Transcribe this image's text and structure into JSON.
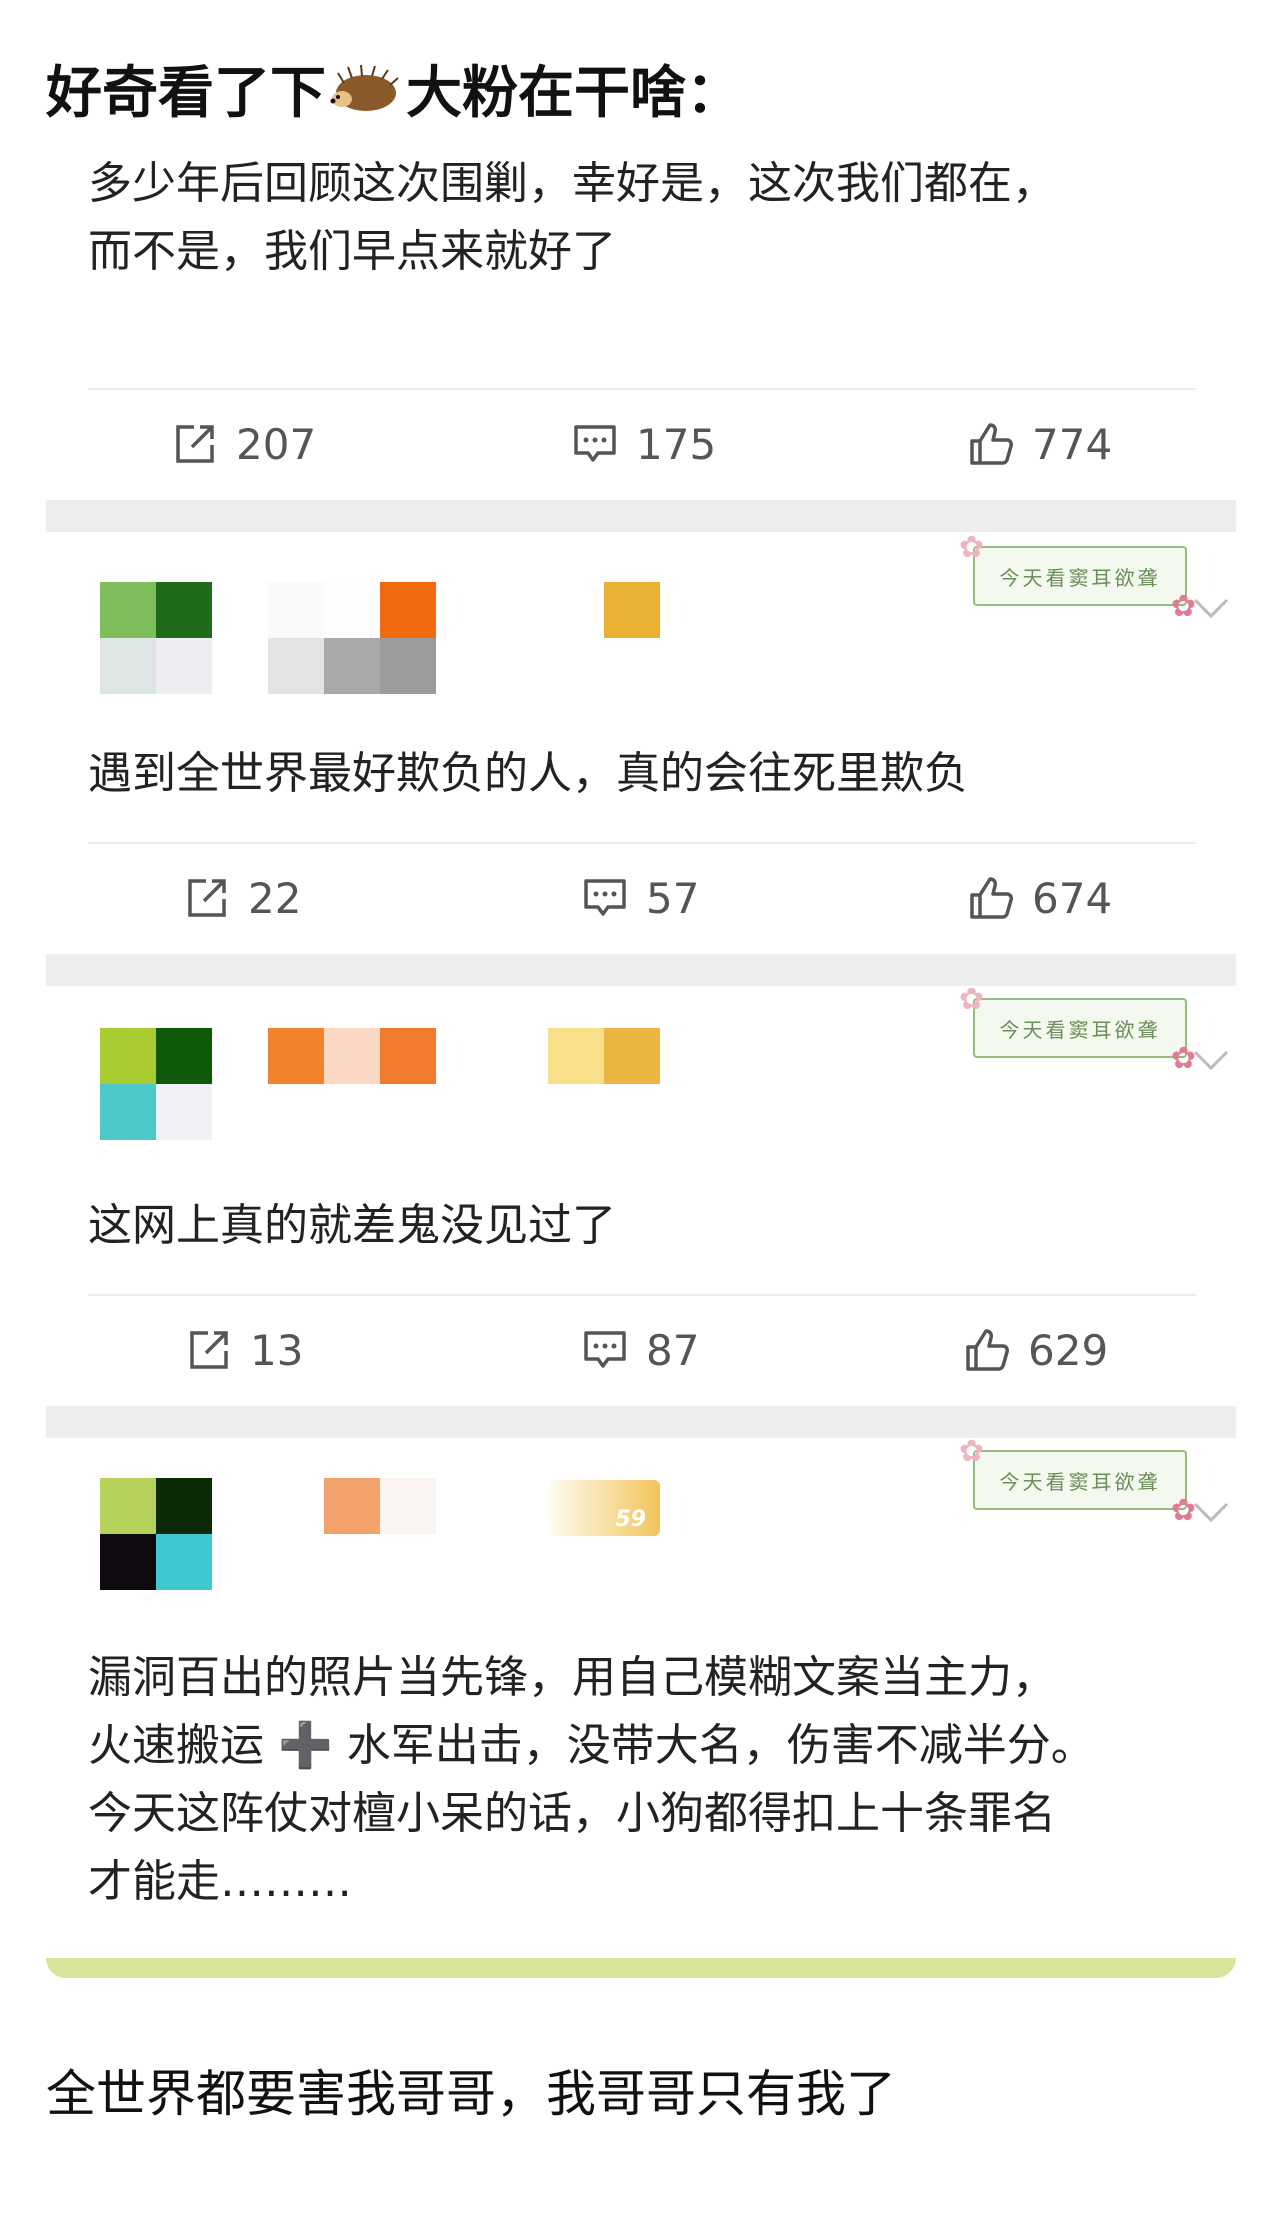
{
  "title": {
    "before": "好奇看了下",
    "after": "大粉在干啥："
  },
  "posts": [
    {
      "text": "多少年后回顾这次围剿，幸好是，这次我们都在，\n而不是，我们早点来就好了",
      "repost": "207",
      "comment": "175",
      "like": "774"
    },
    {
      "badge": "今天看窦耳欲聋",
      "text": "遇到全世界最好欺负的人，真的会往死里欺负",
      "repost": "22",
      "comment": "57",
      "like": "674"
    },
    {
      "badge": "今天看窦耳欲聋",
      "text": "这网上真的就差鬼没见过了",
      "repost": "13",
      "comment": "87",
      "like": "629"
    },
    {
      "badge": "今天看窦耳欲聋",
      "level": "59",
      "text": "漏洞百出的照片当先锋，用自己模糊文案当主力，\n火速搬运 ➕ 水军出击，没带大名，伤害不减半分。\n今天这阵仗对檀小呆的话，小狗都得扣上十条罪名\n才能走………"
    }
  ],
  "footer_text": "全世界都要害我哥哥，我哥哥只有我了",
  "colors": {
    "text": "#222222",
    "divider": "#eeeeee",
    "accent_green": "#d6e59a"
  }
}
